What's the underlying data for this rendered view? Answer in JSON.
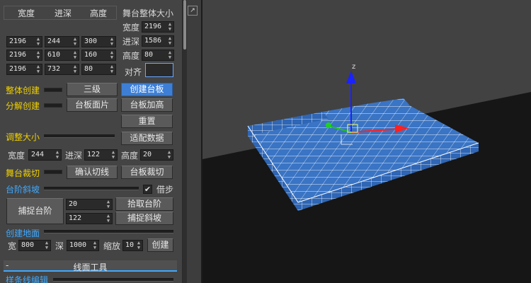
{
  "panel": {
    "table_headers": [
      "宽度",
      "进深",
      "高度"
    ],
    "rows": [
      {
        "width": "2196",
        "depth": "244",
        "height": "300"
      },
      {
        "width": "2196",
        "depth": "610",
        "height": "160"
      },
      {
        "width": "2196",
        "depth": "732",
        "height": "80"
      }
    ],
    "stage_size": {
      "title": "舞台整体大小",
      "width_label": "宽度",
      "width_value": "2196",
      "depth_label": "进深",
      "depth_value": "1586",
      "height_label": "高度",
      "height_value": "80",
      "align_label": "对齐"
    },
    "whole_create_label": "整体创建",
    "three_level_button": "三级",
    "create_board_button": "创建台板",
    "split_create_label": "分解创建",
    "board_face_button": "台板面片",
    "board_raise_button": "台板加高",
    "reset_button": "重置",
    "adjust_size_label": "调整大小",
    "fit_data_button": "适配数据",
    "adj_width_label": "宽度",
    "adj_width_value": "244",
    "adj_depth_label": "进深",
    "adj_depth_value": "122",
    "adj_height_label": "高度",
    "adj_height_value": "20",
    "stage_cut_label": "舞台裁切",
    "confirm_cut_button": "确认切线",
    "board_cut_button": "台板裁切",
    "step_slope_label": "台阶斜坡",
    "borrow_step_label": "借步",
    "borrow_step_checked": "✔",
    "capture_step_button": "捕捉台阶",
    "step_value_1": "20",
    "step_value_2": "122",
    "pick_step_button": "拾取台阶",
    "capture_slope_button": "捕捉斜坡",
    "create_ground_label": "创建地面",
    "ground_width_label": "宽",
    "ground_width_value": "800",
    "ground_depth_label": "深",
    "ground_depth_value": "1000",
    "ground_scale_label": "缩放",
    "ground_scale_value": "10",
    "ground_create_button": "创建",
    "rollout_minus": "-",
    "rollout_title": "线面工具",
    "spline_edit_label": "样条线编辑"
  },
  "viewport": {
    "gizmo_z_label": "z",
    "floor_color": "#161616",
    "backdrop_color": "#424242",
    "stage_color": "#3a74c4"
  }
}
